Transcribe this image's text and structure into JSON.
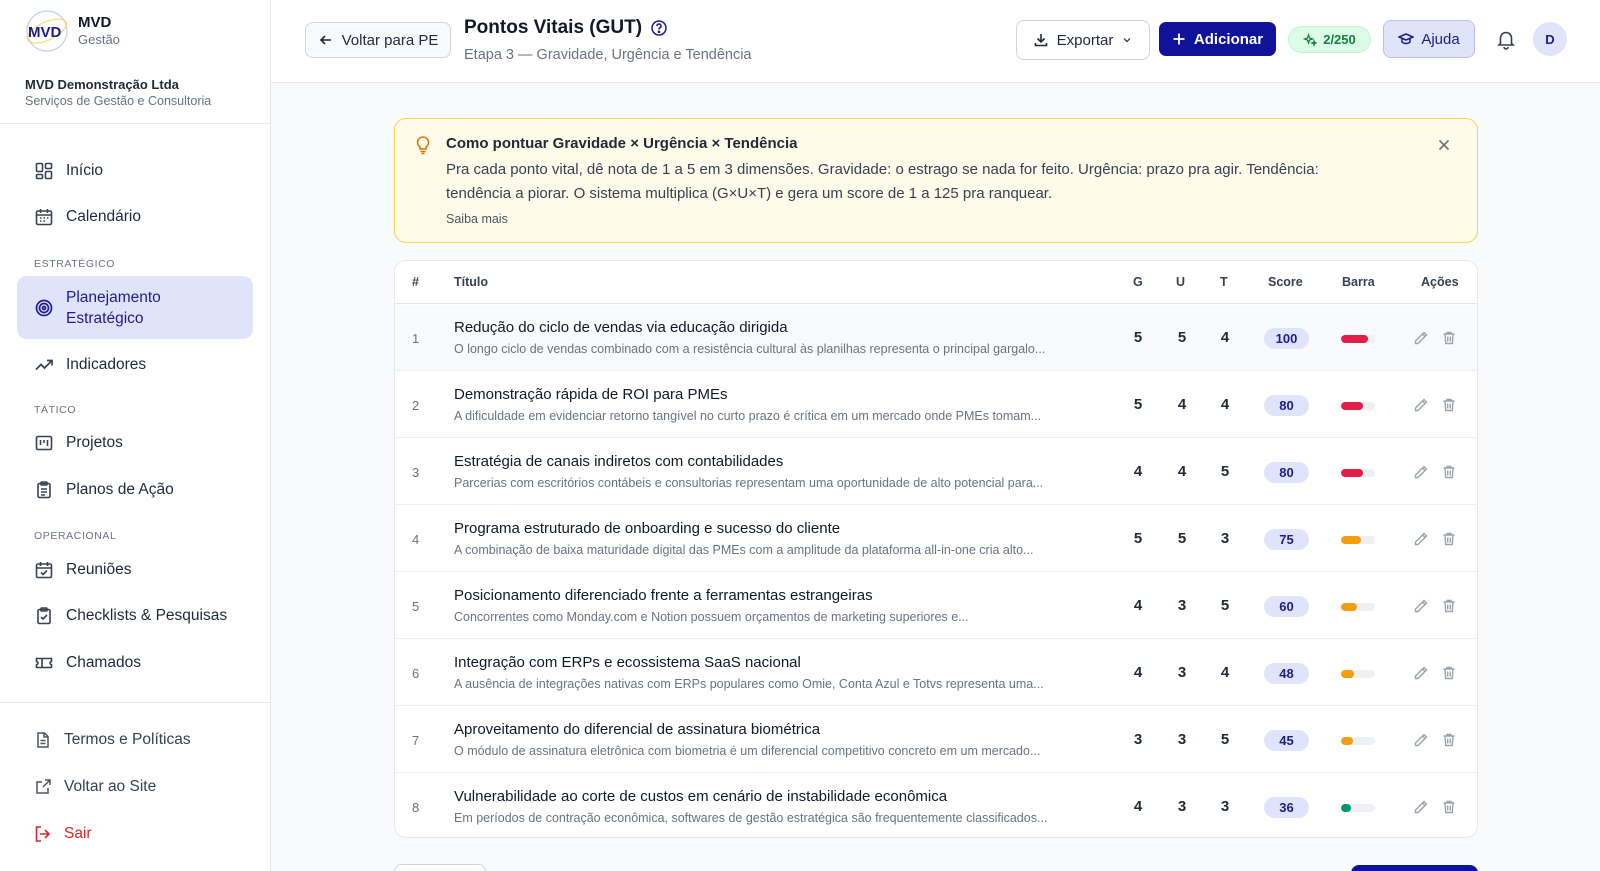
{
  "brand": {
    "name": "MVD",
    "subtitle": "Gestão",
    "logo_text": "MVD"
  },
  "company": {
    "name": "MVD Demonstração Ltda",
    "tagline": "Serviços de Gestão e Consultoria"
  },
  "sidebar": {
    "top_items": [
      {
        "label": "Início",
        "icon": "dashboard-icon"
      },
      {
        "label": "Calendário",
        "icon": "calendar-icon"
      }
    ],
    "sections": [
      {
        "title": "ESTRATÉGICO",
        "items": [
          {
            "label": "Planejamento Estratégico",
            "icon": "target-icon",
            "active": true
          },
          {
            "label": "Indicadores",
            "icon": "trending-up-icon"
          }
        ]
      },
      {
        "title": "TÁTICO",
        "items": [
          {
            "label": "Projetos",
            "icon": "kanban-icon"
          },
          {
            "label": "Planos de Ação",
            "icon": "clipboard-list-icon"
          }
        ]
      },
      {
        "title": "OPERACIONAL",
        "items": [
          {
            "label": "Reuniões",
            "icon": "calendar-check-icon"
          },
          {
            "label": "Checklists & Pesquisas",
            "icon": "clipboard-check-icon"
          },
          {
            "label": "Chamados",
            "icon": "ticket-icon"
          }
        ]
      }
    ],
    "footer": [
      {
        "label": "Termos e Políticas",
        "icon": "document-icon"
      },
      {
        "label": "Voltar ao Site",
        "icon": "external-link-icon"
      },
      {
        "label": "Sair",
        "icon": "logout-icon"
      }
    ]
  },
  "header": {
    "back_label": "Voltar para PE",
    "title": "Pontos Vitais (GUT)",
    "subtitle": "Etapa 3 — Gravidade, Urgência e Tendência",
    "export_label": "Exportar",
    "add_label": "Adicionar",
    "credits": "2/250",
    "help_label": "Ajuda",
    "avatar_initial": "D"
  },
  "banner": {
    "title": "Como pontuar Gravidade × Urgência × Tendência",
    "text": "Pra cada ponto vital, dê nota de 1 a 5 em 3 dimensões. Gravidade: o estrago se nada for feito. Urgência: prazo pra agir. Tendência: tendência a piorar. O sistema multiplica (G×U×T) e gera um score de 1 a 125 pra ranquear.",
    "link": "Saiba mais"
  },
  "table": {
    "headers": {
      "num": "#",
      "title": "Título",
      "g": "G",
      "u": "U",
      "t": "T",
      "score": "Score",
      "bar": "Barra",
      "actions": "Ações"
    },
    "rows": [
      {
        "num": "1",
        "title": "Redução do ciclo de vendas via educação dirigida",
        "desc": "O longo ciclo de vendas combinado com a resistência cultural às planilhas representa o principal gargalo...",
        "g": "5",
        "u": "5",
        "t": "4",
        "score": "100",
        "bar_fraction": 0.8,
        "bar_color": "#e11d48"
      },
      {
        "num": "2",
        "title": "Demonstração rápida de ROI para PMEs",
        "desc": "A dificuldade em evidenciar retorno tangível no curto prazo é crítica em um mercado onde PMEs tomam...",
        "g": "5",
        "u": "4",
        "t": "4",
        "score": "80",
        "bar_fraction": 0.64,
        "bar_color": "#e11d48"
      },
      {
        "num": "3",
        "title": "Estratégia de canais indiretos com contabilidades",
        "desc": "Parcerias com escritórios contábeis e consultorias representam uma oportunidade de alto potencial para...",
        "g": "4",
        "u": "4",
        "t": "5",
        "score": "80",
        "bar_fraction": 0.64,
        "bar_color": "#e11d48"
      },
      {
        "num": "4",
        "title": "Programa estruturado de onboarding e sucesso do cliente",
        "desc": "A combinação de baixa maturidade digital das PMEs com a amplitude da plataforma all-in-one cria alto...",
        "g": "5",
        "u": "5",
        "t": "3",
        "score": "75",
        "bar_fraction": 0.6,
        "bar_color": "#f59e0b"
      },
      {
        "num": "5",
        "title": "Posicionamento diferenciado frente a ferramentas estrangeiras",
        "desc": "Concorrentes como Monday.com e Notion possuem orçamentos de marketing superiores e...",
        "g": "4",
        "u": "3",
        "t": "5",
        "score": "60",
        "bar_fraction": 0.48,
        "bar_color": "#f59e0b"
      },
      {
        "num": "6",
        "title": "Integração com ERPs e ecossistema SaaS nacional",
        "desc": "A ausência de integrações nativas com ERPs populares como Omie, Conta Azul e Totvs representa uma...",
        "g": "4",
        "u": "3",
        "t": "4",
        "score": "48",
        "bar_fraction": 0.38,
        "bar_color": "#f59e0b"
      },
      {
        "num": "7",
        "title": "Aproveitamento do diferencial de assinatura biométrica",
        "desc": "O módulo de assinatura eletrônica com biometria é um diferencial competitivo concreto em um mercado...",
        "g": "3",
        "u": "3",
        "t": "5",
        "score": "45",
        "bar_fraction": 0.36,
        "bar_color": "#f59e0b"
      },
      {
        "num": "8",
        "title": "Vulnerabilidade ao corte de custos em cenário de instabilidade econômica",
        "desc": "Em períodos de contração econômica, softwares de gestão estratégica são frequentemente classificados...",
        "g": "4",
        "u": "3",
        "t": "3",
        "score": "36",
        "bar_fraction": 0.29,
        "bar_color": "#059669"
      }
    ]
  }
}
